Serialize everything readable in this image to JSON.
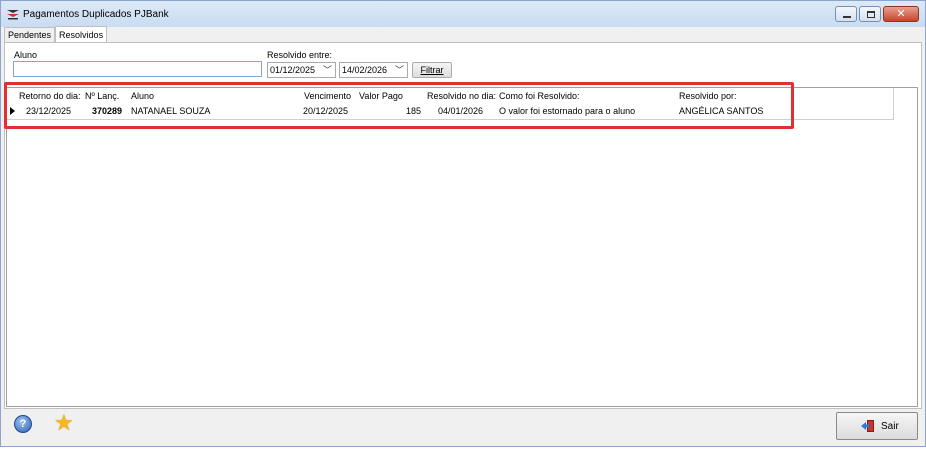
{
  "window": {
    "title": "Pagamentos Duplicados PJBank",
    "close_glyph": "✕"
  },
  "tabs": [
    {
      "label": "Pendentes",
      "active": false
    },
    {
      "label": "Resolvidos",
      "active": true
    }
  ],
  "filters": {
    "aluno_label": "Aluno",
    "aluno_value": "",
    "resolvido_label": "Resolvido entre:",
    "date_from": "01/12/2025",
    "date_to": "14/02/2026",
    "filter_button": "Filtrar"
  },
  "table": {
    "columns": [
      "Retorno do dia:",
      "Nº Lanç.",
      "Aluno",
      "Vencimento",
      "Valor Pago",
      "Resolvido no dia:",
      "Como foi Resolvido:",
      "Resolvido por:"
    ],
    "rows": [
      {
        "retorno": "23/12/2025",
        "lanc": "370289",
        "aluno": "NATANAEL SOUZA",
        "vencimento": "20/12/2025",
        "valor": "185",
        "resolvido_dia": "04/01/2026",
        "como": "O valor foi estornado para o aluno",
        "por": "ANGÉLICA SANTOS"
      }
    ]
  },
  "footer": {
    "help_glyph": "?",
    "star_glyph": "★",
    "exit_button": "Sair"
  },
  "icons": {
    "app": "app-logo-icon",
    "help": "help-icon",
    "favorite": "star-icon",
    "exit": "exit-door-icon"
  },
  "colors": {
    "highlight": "#e03030",
    "star": "#f5b821"
  }
}
